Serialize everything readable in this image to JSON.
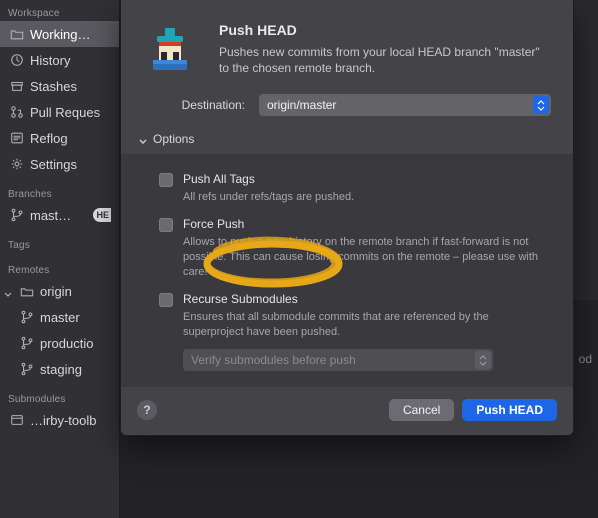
{
  "sidebar": {
    "groups": {
      "workspace": {
        "header": "Workspace",
        "items": [
          {
            "label": "Working…"
          },
          {
            "label": "History"
          },
          {
            "label": "Stashes"
          },
          {
            "label": "Pull Reques"
          },
          {
            "label": "Reflog"
          },
          {
            "label": "Settings"
          }
        ]
      },
      "branches": {
        "header": "Branches",
        "items": [
          {
            "label": "mast…",
            "badge": "HE"
          }
        ]
      },
      "tags": {
        "header": "Tags"
      },
      "remotes": {
        "header": "Remotes",
        "root": {
          "label": "origin"
        },
        "items": [
          {
            "label": "master"
          },
          {
            "label": "productio"
          },
          {
            "label": "staging"
          }
        ]
      },
      "submodules": {
        "header": "Submodules",
        "items": [
          {
            "label": "…irby-toolb"
          }
        ]
      }
    }
  },
  "dialog": {
    "title": "Push HEAD",
    "subtitle": "Pushes new commits from your local HEAD branch \"master\" to the chosen remote branch.",
    "destination_label": "Destination:",
    "destination_value": "origin/master",
    "options_label": "Options",
    "options": {
      "push_all_tags": {
        "label": "Push All Tags",
        "desc": "All refs under refs/tags are pushed."
      },
      "force_push": {
        "label": "Force Push",
        "desc": "Allows to push a new history on the remote branch if fast-forward is not possible. This can cause losing commits on the remote – please use with care!"
      },
      "recurse_submodules": {
        "label": "Recurse Submodules",
        "desc": "Ensures that all submodule commits that are referenced by the superproject have been pushed.",
        "verify_placeholder": "Verify submodules before push"
      }
    },
    "buttons": {
      "help": "?",
      "cancel": "Cancel",
      "primary": "Push HEAD"
    }
  },
  "main": {
    "side_text": "od"
  }
}
